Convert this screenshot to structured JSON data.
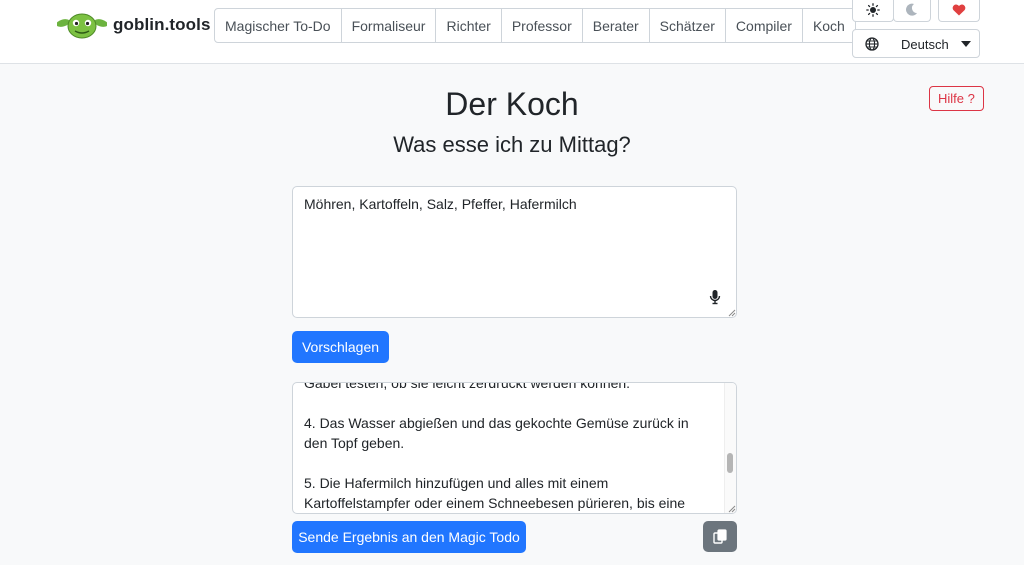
{
  "brand": {
    "name": "goblin.tools"
  },
  "nav": {
    "tabs": [
      {
        "label": "Magischer To-Do"
      },
      {
        "label": "Formaliseur"
      },
      {
        "label": "Richter"
      },
      {
        "label": "Professor"
      },
      {
        "label": "Berater"
      },
      {
        "label": "Schätzer"
      },
      {
        "label": "Compiler"
      },
      {
        "label": "Koch"
      }
    ],
    "language": "Deutsch"
  },
  "help": {
    "label": "Hilfe ?"
  },
  "page": {
    "title": "Der Koch",
    "subtitle": "Was esse ich zu Mittag?"
  },
  "input": {
    "value": "Möhren, Kartoffeln, Salz, Pfeffer, Hafermilch"
  },
  "actions": {
    "suggest_label": "Vorschlagen",
    "send_label": "Sende Ergebnis an den Magic Todo"
  },
  "output": {
    "text": "Gabel testen, ob sie leicht zerdrückt werden können.\n\n4. Das Wasser abgießen und das gekochte Gemüse zurück in den Topf geben.\n\n5. Die Hafermilch hinzufügen und alles mit einem Kartoffelstampfer oder einem Schneebesen pürieren, bis eine cremige Konsistenz"
  },
  "colors": {
    "primary": "#2176ff",
    "danger": "#dc3545",
    "secondary": "#6c757d",
    "heart": "#e04040"
  }
}
